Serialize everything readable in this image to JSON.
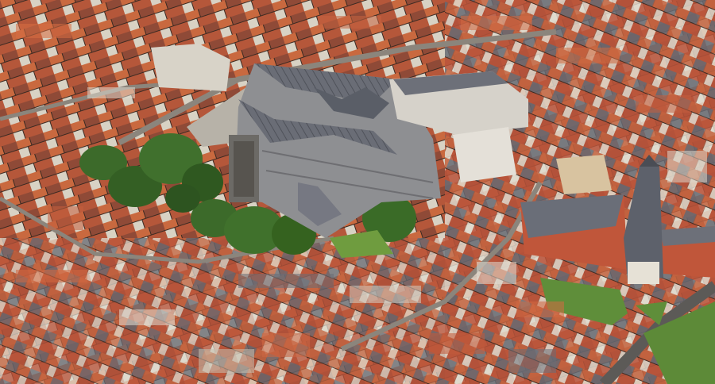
{
  "image": {
    "kind": "aerial-photograph",
    "colors": {
      "roof_red": "#b5573a",
      "roof_orange": "#c9693f",
      "roof_slate": "#5f6470",
      "stone": "#c8c2b6",
      "tree": "#3c6a2a",
      "lawn": "#5f8e3a",
      "plaza": "#b7b2a8",
      "brick": "#c0563a"
    }
  }
}
